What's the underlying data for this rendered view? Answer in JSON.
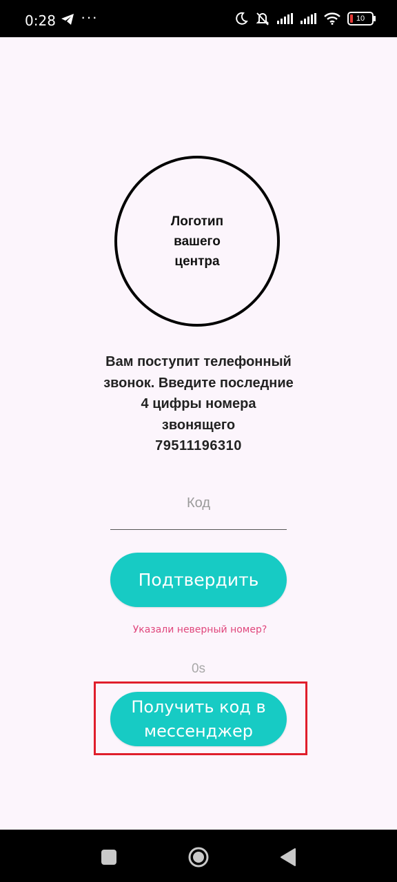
{
  "status_bar": {
    "time": "0:28",
    "more_glyph": "···",
    "battery_level": "10",
    "icons": [
      "telegram-icon",
      "moon-icon",
      "mute-icon",
      "signal-icon",
      "signal-icon",
      "wifi-icon",
      "battery-icon"
    ]
  },
  "logo": {
    "text": "Логотип вашего центра"
  },
  "instructions": {
    "text": "Вам поступит телефонный звонок. Введите последние 4 цифры номера звонящего",
    "phone": "79511196310"
  },
  "code_input": {
    "placeholder": "Код",
    "value": ""
  },
  "confirm_button": {
    "label": "Подтвердить"
  },
  "wrong_number_link": {
    "label": "Указали неверный номер?"
  },
  "timer": {
    "text": "0s"
  },
  "messenger_button": {
    "label": "Получить код в мессенджер"
  },
  "colors": {
    "background": "#fcf5fc",
    "accent": "#17cbc4",
    "link": "#e0467c",
    "highlight": "#e01e2b"
  },
  "nav_bar": {
    "icons": [
      "recents-icon",
      "home-icon",
      "back-icon"
    ]
  }
}
